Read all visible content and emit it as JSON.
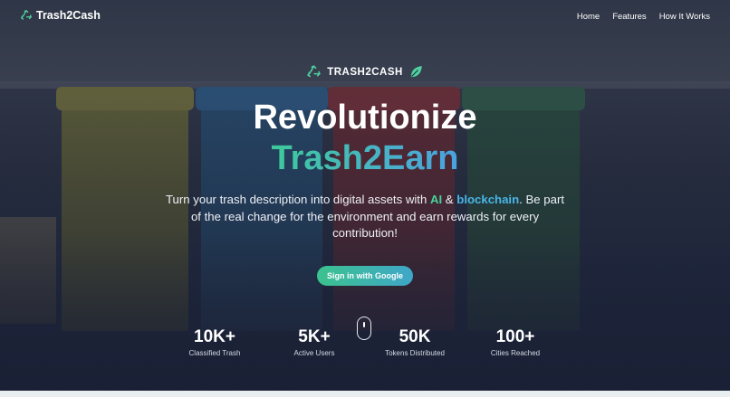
{
  "nav": {
    "brand": "Trash2Cash",
    "links": [
      "Home",
      "Features",
      "How It Works"
    ]
  },
  "hero": {
    "badge": "TRASH2CASH",
    "title_line1": "Revolutionize",
    "title_line2": "Trash2Earn",
    "desc_part1": "Turn your trash description into digital assets with ",
    "desc_ai": "AI",
    "desc_amp": " & ",
    "desc_blockchain": "blockchain",
    "desc_part2": ". Be part of the real change for the environment and earn rewards for every contribution!",
    "cta": "Sign in with Google"
  },
  "stats": [
    {
      "value": "10K+",
      "label": "Classified Trash"
    },
    {
      "value": "5K+",
      "label": "Active Users"
    },
    {
      "value": "50K",
      "label": "Tokens Distributed"
    },
    {
      "value": "100+",
      "label": "Cities Reached"
    }
  ],
  "colors": {
    "accent_green": "#46d39c",
    "accent_blue": "#49b6e8"
  },
  "icons": {
    "brand": "recycle-icon",
    "badge_left": "recycle-icon",
    "badge_right": "leaf-icon"
  }
}
